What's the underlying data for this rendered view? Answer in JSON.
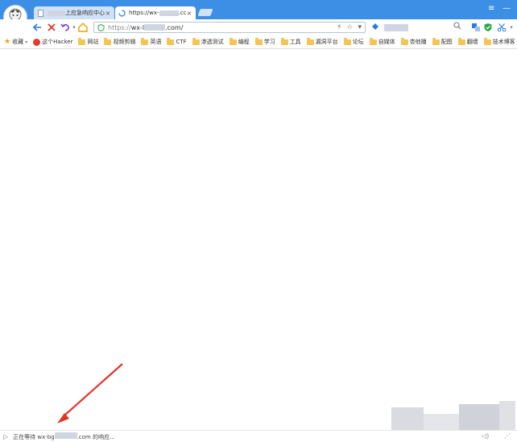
{
  "window": {
    "menu_icon": "≡",
    "minimize_icon": "—"
  },
  "tabs": [
    {
      "label": "上应急响应中心",
      "close": "×",
      "icon": "page-icon"
    },
    {
      "label": "https://wx-",
      "label_suffix": ".cc",
      "close": "×",
      "icon": "loading-spinner-icon"
    }
  ],
  "toolbar": {
    "back": "back-arrow-icon",
    "stop": "stop-x-icon",
    "reload": "undo-reload-icon",
    "home": "home-icon",
    "address": {
      "scheme": "https://",
      "host_start": "wx-l",
      "host_end": ".com/"
    },
    "address_right": {
      "lightning": "⚡",
      "star": "☆",
      "caret": "▾"
    }
  },
  "bookmarks": [
    {
      "label": "收藏",
      "type": "favorites"
    },
    {
      "label": "这个Hacker",
      "type": "site"
    },
    {
      "label": "网站",
      "type": "folder"
    },
    {
      "label": "视频剪辑",
      "type": "folder"
    },
    {
      "label": "英语",
      "type": "folder"
    },
    {
      "label": "CTF",
      "type": "folder"
    },
    {
      "label": "渗透测试",
      "type": "folder"
    },
    {
      "label": "编程",
      "type": "folder"
    },
    {
      "label": "学习",
      "type": "folder"
    },
    {
      "label": "工具",
      "type": "folder"
    },
    {
      "label": "漏洞平台",
      "type": "folder"
    },
    {
      "label": "论坛",
      "type": "folder"
    },
    {
      "label": "自媒体",
      "type": "folder"
    },
    {
      "label": "杏他播",
      "type": "folder"
    },
    {
      "label": "配图",
      "type": "folder"
    },
    {
      "label": "翻墙",
      "type": "folder"
    },
    {
      "label": "技术博客",
      "type": "folder"
    }
  ],
  "status": {
    "prefix": "正在等待 wx-bg",
    "suffix": ".com 的响应..."
  },
  "colors": {
    "titlebar": "#3d8fe6",
    "arrow": "#e0352b",
    "accent": "#2a7be0"
  }
}
